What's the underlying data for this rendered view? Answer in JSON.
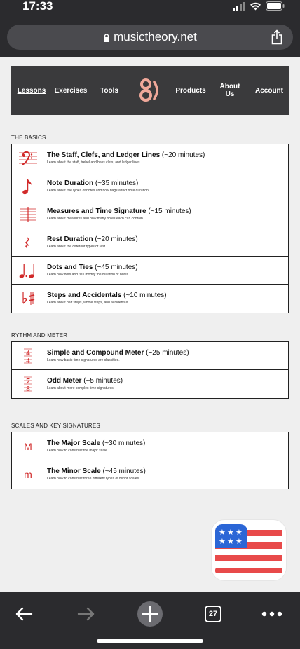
{
  "status": {
    "time": "17:33"
  },
  "browser": {
    "url_host": "musictheory.net",
    "tab_count": "27"
  },
  "nav": {
    "lessons": "Lessons",
    "exercises": "Exercises",
    "tools": "Tools",
    "products": "Products",
    "about": "About Us",
    "account": "Account"
  },
  "sections": [
    {
      "title": "THE BASICS",
      "lessons": [
        {
          "icon": "bass-clef-icon",
          "name": "The Staff, Clefs, and Ledger Lines",
          "duration": "(~20 minutes)",
          "desc": "Learn about the staff, trebel and bass clefs, and ledger lines."
        },
        {
          "icon": "eighth-note-icon",
          "name": "Note Duration",
          "duration": "(~35 minutes)",
          "desc": "Learn about five types of notes and how flags affect note duration."
        },
        {
          "icon": "staff-lines-icon",
          "name": "Measures and Time Signature",
          "duration": "(~15 minutes)",
          "desc": "Learn about measures and how many notes each can contain."
        },
        {
          "icon": "quarter-rest-icon",
          "name": "Rest Duration",
          "duration": "(~20 minutes)",
          "desc": "Learn about the different types of rest."
        },
        {
          "icon": "dotted-notes-icon",
          "name": "Dots and Ties",
          "duration": "(~45 minutes)",
          "desc": "Learn how dots and ties modify the duration of notes."
        },
        {
          "icon": "accidentals-icon",
          "name": "Steps and Accidentals",
          "duration": "(~10 minutes)",
          "desc": "Learn about half steps, whole steps, and accidentals."
        }
      ]
    },
    {
      "title": "RYTHM AND METER",
      "lessons": [
        {
          "icon": "time-signature-4-4-icon",
          "name": "Simple and Compound Meter",
          "duration": "(~25 minutes)",
          "desc": "Learn how basic time signatures are classified."
        },
        {
          "icon": "time-signature-7-8-icon",
          "name": "Odd Meter",
          "duration": "(~5 minutes)",
          "desc": "Learn about more complex time signatures."
        }
      ]
    },
    {
      "title": "SCALES AND KEY SIGNATURES",
      "lessons": [
        {
          "icon": "major-m-icon",
          "name": "The Major Scale",
          "duration": "(~30 minutes)",
          "desc": "Learn how to construct the major scale.",
          "glyph": "M"
        },
        {
          "icon": "minor-m-icon",
          "name": "The Minor Scale",
          "duration": "(~45 minutes)",
          "desc": "Learn how to construct three different types of minor scales.",
          "glyph": "m"
        }
      ]
    }
  ],
  "colors": {
    "accent": "#d12a2a",
    "nav_bg": "#3a3a3c",
    "chrome_bg": "#2b2b2e",
    "logo": "#f0a89a"
  },
  "extras": {
    "time_sig_1": [
      "4",
      "4"
    ],
    "time_sig_2": [
      "7",
      "8"
    ]
  }
}
